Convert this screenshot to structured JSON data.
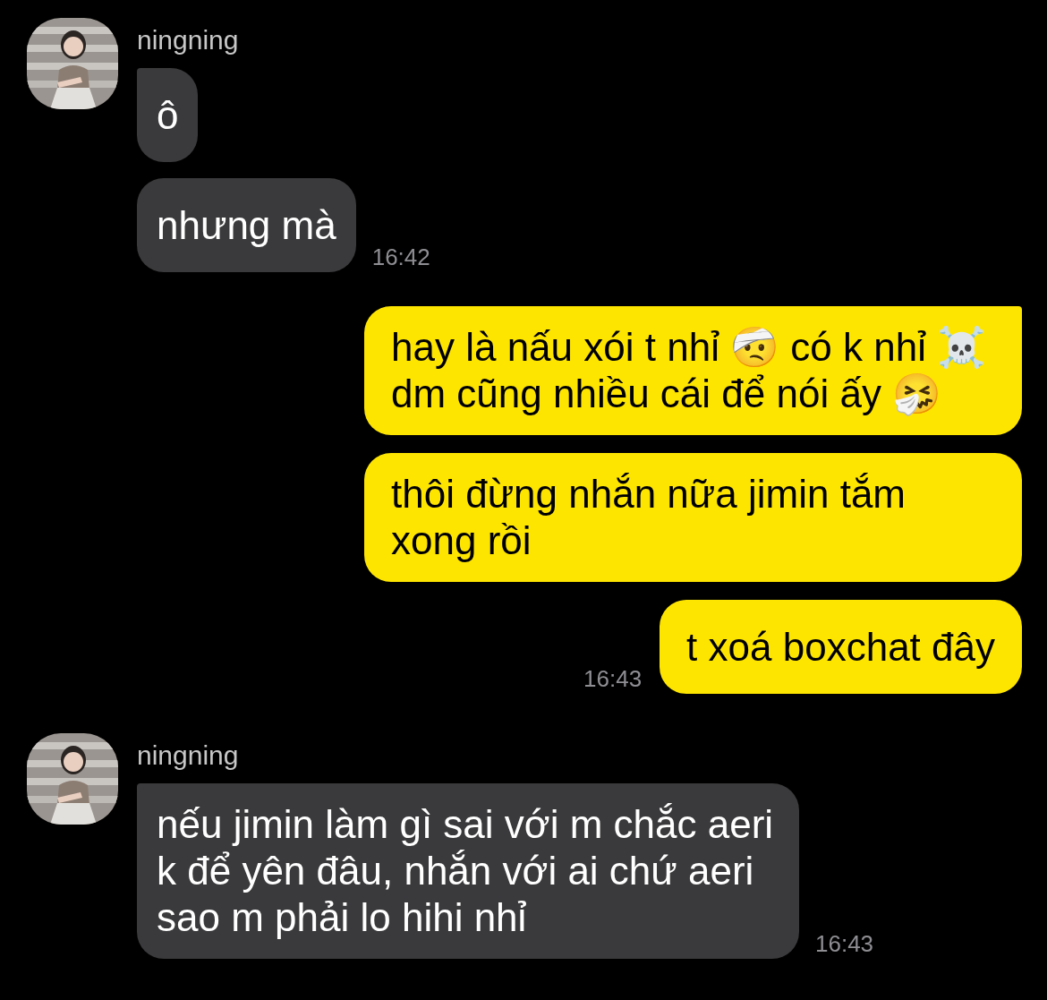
{
  "groups": [
    {
      "kind": "incoming",
      "sender": "ningning",
      "messages": [
        {
          "text": "ô"
        },
        {
          "text": "nhưng mà",
          "time": "16:42"
        }
      ]
    },
    {
      "kind": "outgoing",
      "messages": [
        {
          "text": "hay là nấu xói t nhỉ 🤕 có k nhỉ ☠️ dm cũng nhiều cái để nói ấy 🤧"
        },
        {
          "text": "thôi đừng nhắn nữa jimin tắm xong rồi"
        },
        {
          "text": "t xoá boxchat đây",
          "time": "16:43"
        }
      ]
    },
    {
      "kind": "incoming",
      "sender": "ningning",
      "messages": [
        {
          "text": "nếu jimin làm gì sai với m chắc aeri k để yên đâu, nhắn với ai chứ aeri sao m phải lo hihi nhỉ",
          "time": "16:43"
        }
      ]
    }
  ]
}
